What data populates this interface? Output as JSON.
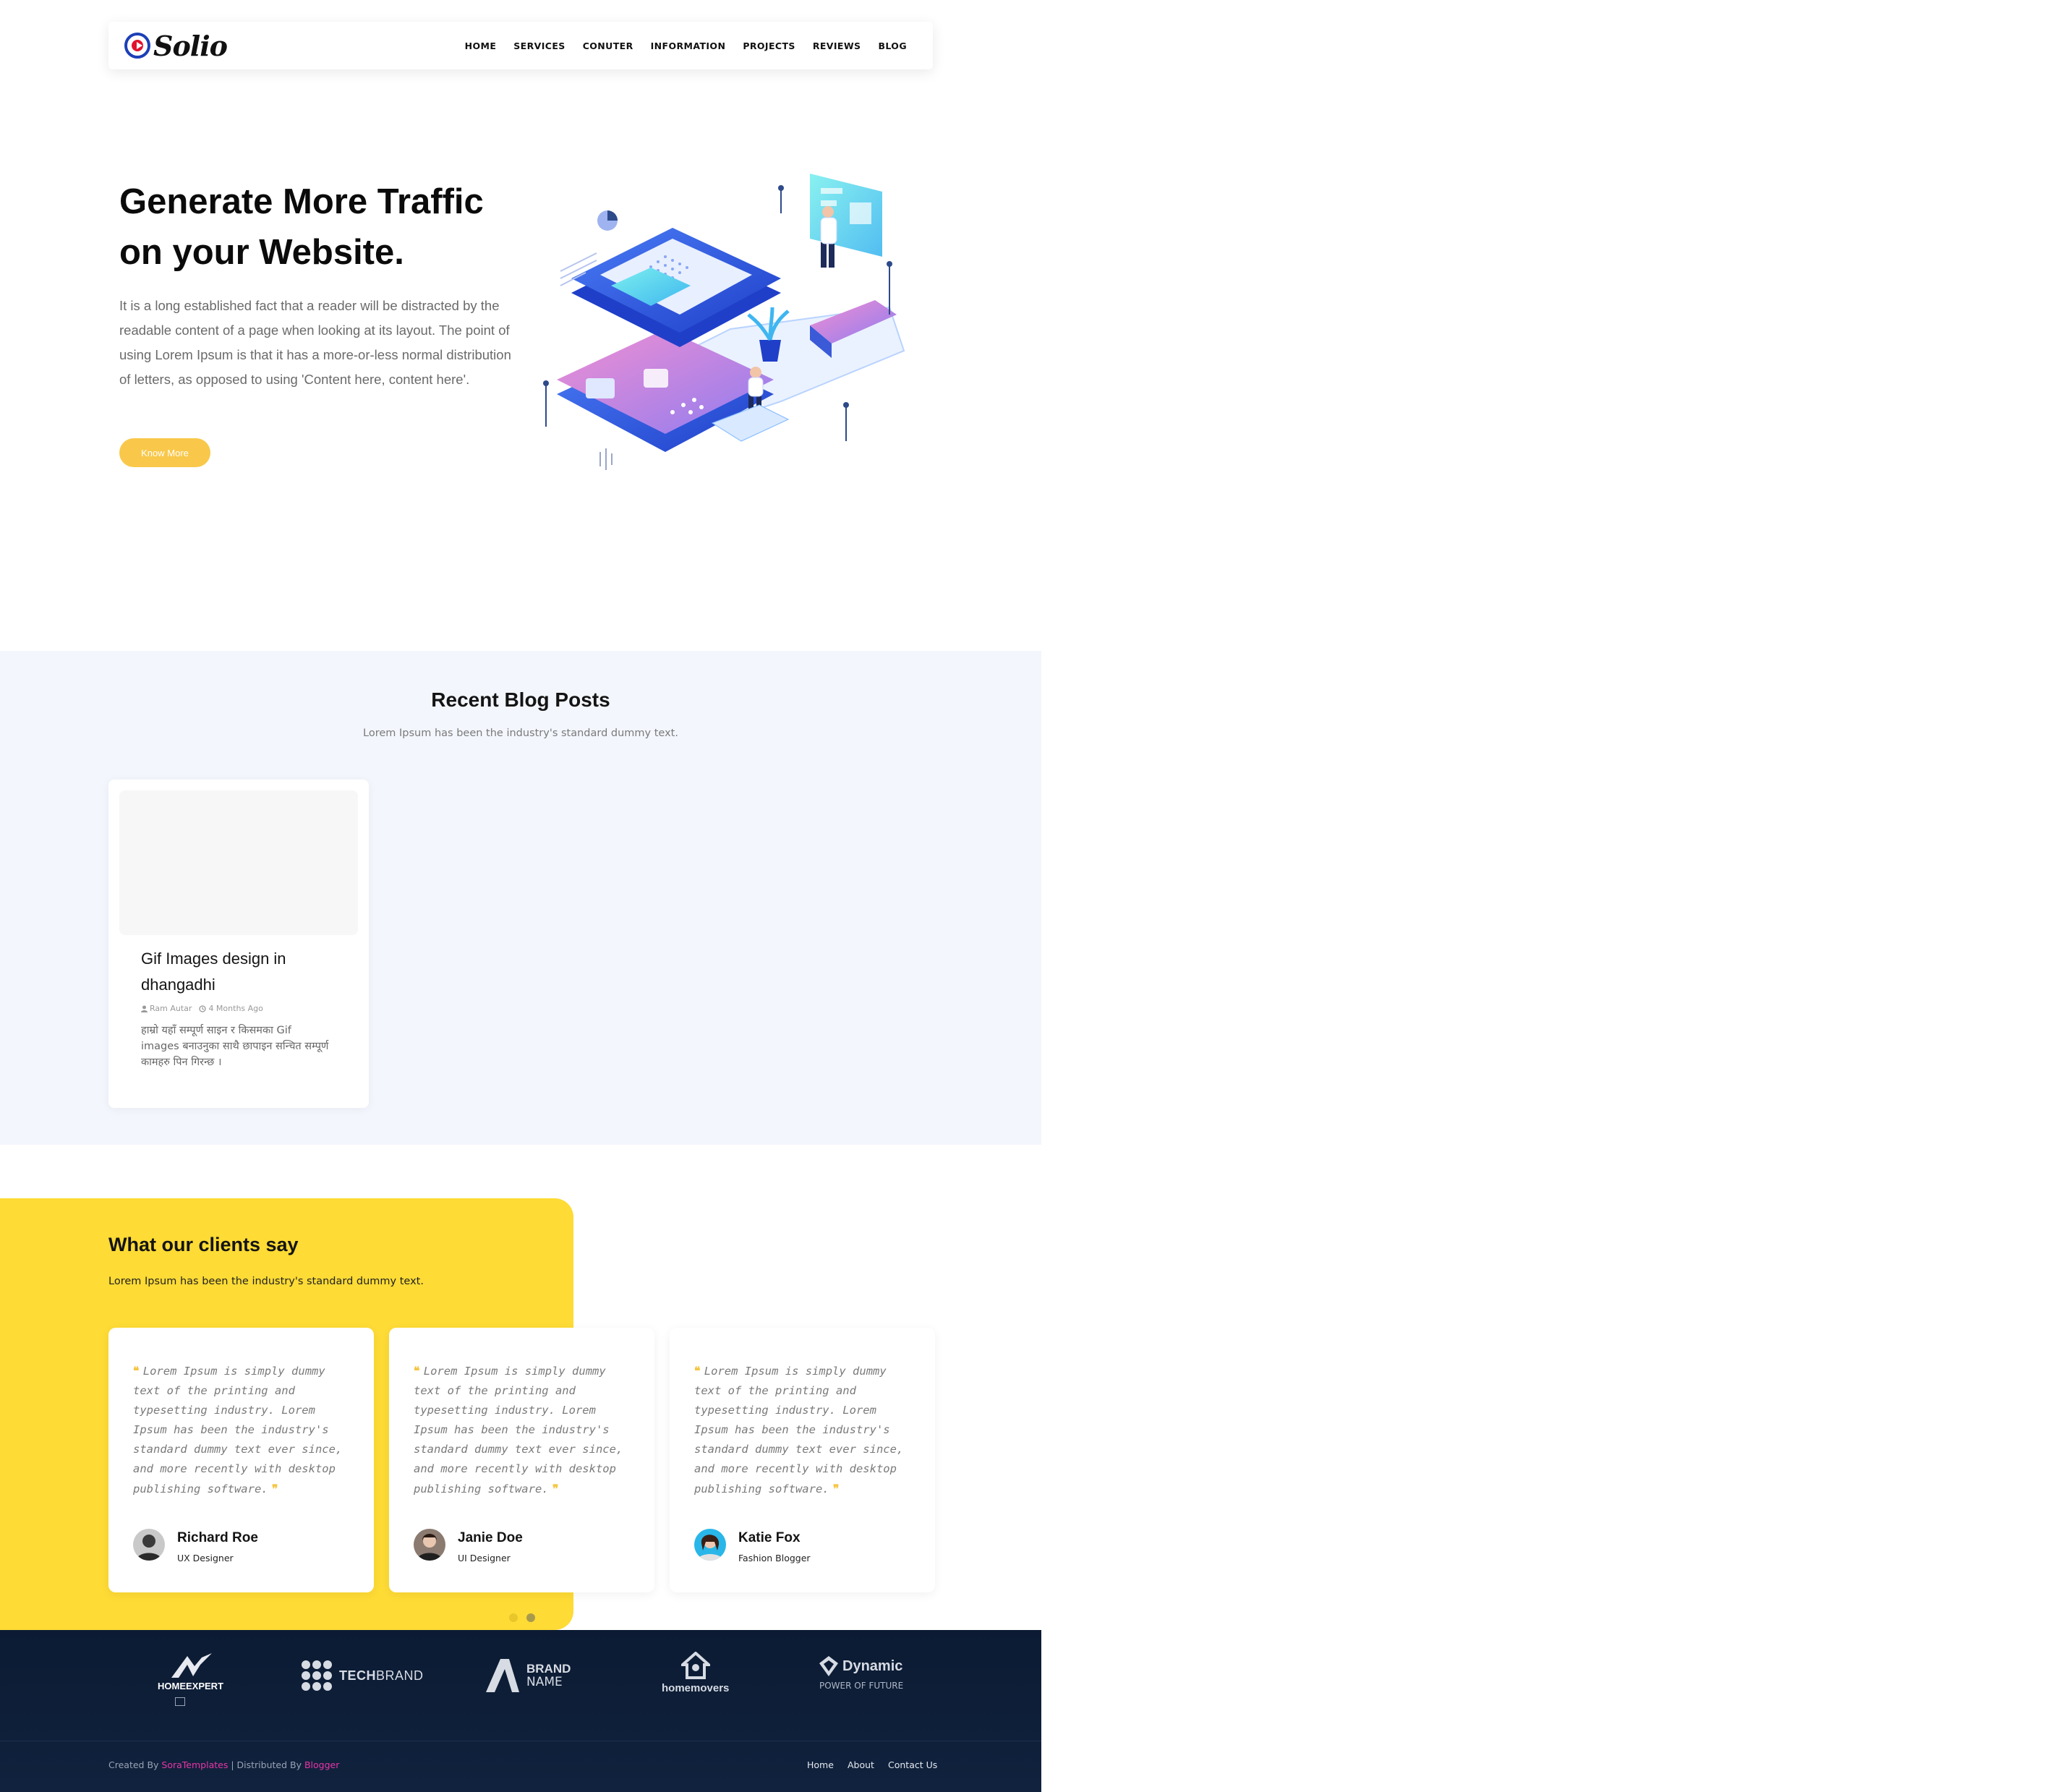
{
  "brand": {
    "name": "Solio"
  },
  "nav": {
    "items": [
      "HOME",
      "SERVICES",
      "CONUTER",
      "INFORMATION",
      "PROJECTS",
      "REVIEWS",
      "BLOG"
    ]
  },
  "hero": {
    "title_line1": "Generate More Traffic",
    "title_line2": "on your Website.",
    "text": "It is a long established fact that a reader will be distracted by the readable content of a page when looking at its layout. The point of using Lorem Ipsum is that it has a more-or-less normal distribution of letters, as opposed to using 'Content here, content here'.",
    "button": "Know More"
  },
  "blog": {
    "title": "Recent Blog Posts",
    "subtitle": "Lorem Ipsum has been the industry's standard dummy text.",
    "posts": [
      {
        "title": "Gif Images design in dhangadhi",
        "author": "Ram Autar",
        "date": "4 Months Ago",
        "excerpt": "हाम्रो यहाँ सम्पूर्ण  साइन र किसमका  Gif images बनाउनुका साथै छापाइन सन्चित सम्पूर्ण कामहरु पिन गिरन्छ ।"
      }
    ]
  },
  "testimonials": {
    "title": "What our clients say",
    "subtitle": "Lorem Ipsum has been the industry's standard dummy text.",
    "items": [
      {
        "quote": "Lorem Ipsum is simply dummy text of the printing and typesetting industry. Lorem Ipsum has been the industry's standard dummy text ever since, and more recently with desktop publishing software.",
        "name": "Richard Roe",
        "role": "UX Designer"
      },
      {
        "quote": "Lorem Ipsum is simply dummy text of the printing and typesetting industry. Lorem Ipsum has been the industry's standard dummy text ever since, and more recently with desktop publishing software.",
        "name": "Janie Doe",
        "role": "UI Designer"
      },
      {
        "quote": "Lorem Ipsum is simply dummy text of the printing and typesetting industry. Lorem Ipsum has been the industry's standard dummy text ever since, and more recently with desktop publishing software.",
        "name": "Katie Fox",
        "role": "Fashion Blogger"
      }
    ]
  },
  "brands": {
    "homeexpert": "HOMEEXPERT",
    "techbrand_a": "TECH",
    "techbrand_b": "BRAND",
    "brandname_a": "BRAND",
    "brandname_b": "NAME",
    "homemovers": "homemovers",
    "dynamic_a": "Dynamic",
    "dynamic_b": "POWER OF FUTURE"
  },
  "footer": {
    "created_by": "Created By",
    "creator": "SoraTemplates",
    "distributed_by": "| Distributed By",
    "distributor": "Blogger",
    "links": [
      "Home",
      "About",
      "Contact Us"
    ]
  },
  "colors": {
    "accent_yellow": "#fedb35",
    "button": "#f9c84a",
    "footer": "#0c1b33",
    "link_pink": "#e935a6"
  }
}
